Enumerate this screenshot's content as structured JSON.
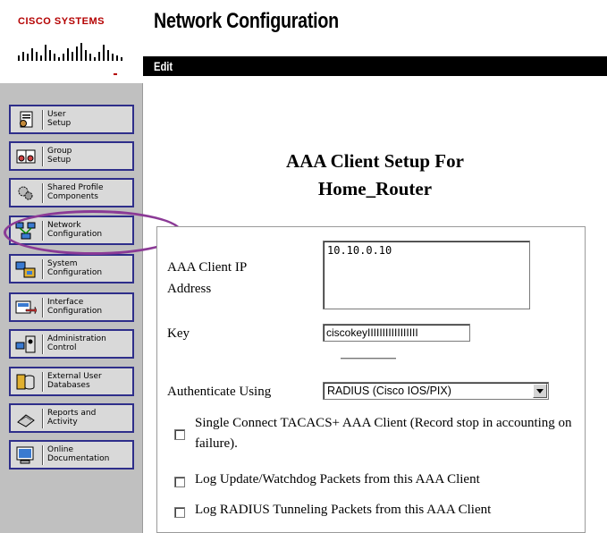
{
  "logo": {
    "text": "CISCO SYSTEMS"
  },
  "header": {
    "title": "Network Configuration",
    "edit_label": "Edit"
  },
  "nav": [
    {
      "label": "User\nSetup",
      "icon": "user-setup-icon"
    },
    {
      "label": "Group\nSetup",
      "icon": "group-setup-icon"
    },
    {
      "label": "Shared Profile\nComponents",
      "icon": "shared-profile-icon"
    },
    {
      "label": "Network\nConfiguration",
      "icon": "network-configuration-icon"
    },
    {
      "label": "System\nConfiguration",
      "icon": "system-configuration-icon"
    },
    {
      "label": "Interface\nConfiguration",
      "icon": "interface-configuration-icon"
    },
    {
      "label": "Administration\nControl",
      "icon": "administration-control-icon"
    },
    {
      "label": "External User\nDatabases",
      "icon": "external-databases-icon"
    },
    {
      "label": "Reports and\nActivity",
      "icon": "reports-activity-icon"
    },
    {
      "label": "Online\nDocumentation",
      "icon": "online-documentation-icon"
    }
  ],
  "main": {
    "setup_title_line1": "AAA Client Setup For",
    "setup_title_line2": "Home_Router"
  },
  "form": {
    "ip_label": "AAA Client IP Address",
    "ip_value": "10.10.0.10",
    "key_label": "Key",
    "key_value": "ciscokeyIIIIIIIIIIIIIIIII",
    "auth_label": "Authenticate Using",
    "auth_value": "RADIUS (Cisco IOS/PIX)",
    "options": [
      {
        "label": "Single Connect TACACS+ AAA Client (Record stop in accounting on failure).",
        "checked": false
      },
      {
        "label": "Log Update/Watchdog Packets from this AAA Client",
        "checked": false
      },
      {
        "label": "Log RADIUS Tunneling Packets from this AAA Client",
        "checked": false
      }
    ]
  },
  "colors": {
    "logo_red": "#b40000",
    "nav_border": "#2e2e8a",
    "highlight_circle": "#8b3a96",
    "sidebar_bg": "#c0c0c0"
  }
}
